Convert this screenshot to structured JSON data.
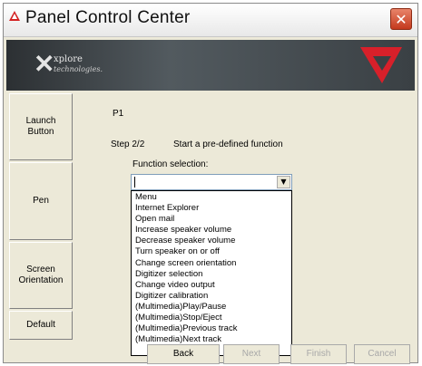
{
  "window": {
    "title": "Panel Control Center",
    "close_glyph": "✕"
  },
  "banner": {
    "logo_line1": "xplore",
    "logo_line2": "technologies.",
    "accent_color": "#d8202a"
  },
  "sidebar": {
    "items": [
      {
        "label": "Launch\nButton"
      },
      {
        "label": "Pen"
      },
      {
        "label": "Screen\nOrientation"
      },
      {
        "label": "Default"
      }
    ]
  },
  "main": {
    "panel_label": "P1",
    "step": "Step 2/2",
    "step_description": "Start a pre-defined function",
    "function_label": "Function selection:",
    "selected_value": ""
  },
  "dropdown": {
    "options": [
      "Menu",
      "Internet Explorer",
      "Open mail",
      "Increase speaker volume",
      "Decrease speaker volume",
      "Turn speaker on or off",
      "Change screen orientation",
      "Digitizer selection",
      "Change video output",
      "Digitizer calibration",
      "(Multimedia)Play/Pause",
      "(Multimedia)Stop/Eject",
      "(Multimedia)Previous track",
      "(Multimedia)Next track"
    ]
  },
  "footer": {
    "back": "Back",
    "next": "Next",
    "finish": "Finish",
    "cancel": "Cancel"
  }
}
